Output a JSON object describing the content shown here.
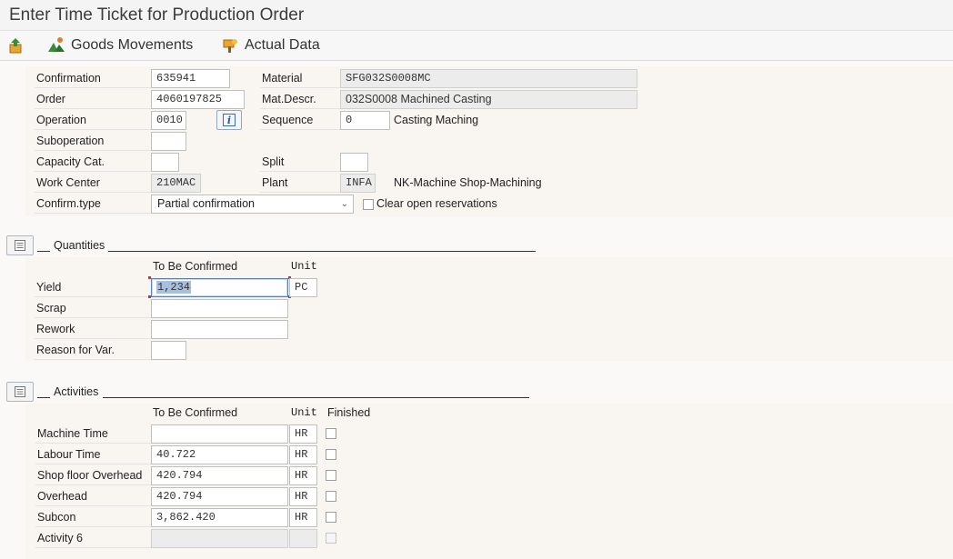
{
  "window": {
    "title": "Enter Time Ticket for Production Order"
  },
  "toolbar": {
    "goods_movements": "Goods Movements",
    "actual_data": "Actual Data"
  },
  "header": {
    "confirmation_label": "Confirmation",
    "confirmation_value": "635941",
    "order_label": "Order",
    "order_value": "4060197825",
    "operation_label": "Operation",
    "operation_value": "0010",
    "suboperation_label": "Suboperation",
    "suboperation_value": "",
    "capacity_label": "Capacity Cat.",
    "capacity_value": "",
    "workcenter_label": "Work Center",
    "workcenter_value": "210MAC",
    "confirmtype_label": "Confirm.type",
    "confirmtype_value": "Partial confirmation",
    "material_label": "Material",
    "material_value": "SFG032S0008MC",
    "matdescr_label": "Mat.Descr.",
    "matdescr_value": "032S0008 Machined Casting",
    "sequence_label": "Sequence",
    "sequence_value": "0",
    "sequence_text": "Casting Maching",
    "split_label": "Split",
    "split_value": "",
    "plant_label": "Plant",
    "plant_value": "INFA",
    "plant_text": "NK-Machine Shop-Machining",
    "clear_reservations_label": "Clear open reservations"
  },
  "quantities": {
    "title": "Quantities",
    "col_to_be_confirmed": "To Be Confirmed",
    "col_unit": "Unit",
    "rows": [
      {
        "label": "Yield",
        "value": "1,234",
        "unit": "PC"
      },
      {
        "label": "Scrap",
        "value": ""
      },
      {
        "label": "Rework",
        "value": ""
      }
    ],
    "reason_label": "Reason for Var.",
    "reason_value": ""
  },
  "activities": {
    "title": "Activities",
    "col_to_be_confirmed": "To Be Confirmed",
    "col_unit": "Unit",
    "col_finished": "Finished",
    "rows": [
      {
        "label": "Machine Time",
        "value": "",
        "unit": "HR"
      },
      {
        "label": "Labour Time",
        "value": "40.722",
        "unit": "HR"
      },
      {
        "label": "Shop floor Overhead",
        "value": "420.794",
        "unit": "HR"
      },
      {
        "label": "Overhead",
        "value": "420.794",
        "unit": "HR"
      },
      {
        "label": "Subcon",
        "value": "3,862.420",
        "unit": "HR"
      },
      {
        "label": "Activity 6",
        "value": "",
        "unit": ""
      }
    ]
  }
}
